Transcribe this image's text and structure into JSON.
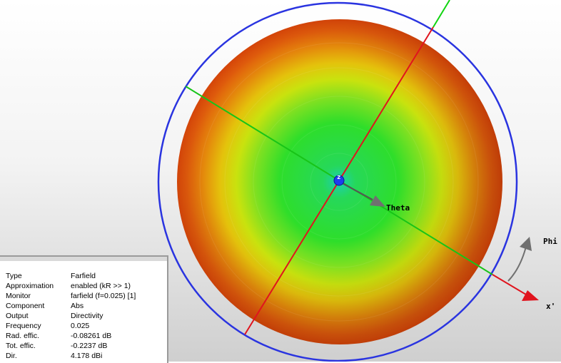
{
  "viewport": {
    "axis_labels": {
      "theta": "Theta",
      "phi": "Phi",
      "x": "x'",
      "z": "z"
    },
    "colors": {
      "boundary_circle": "#2a34e0",
      "axis_red": "#e0141e",
      "axis_green": "#10d410",
      "arrow_gray": "#707070",
      "center_marker": "#1e3cf0"
    }
  },
  "info": {
    "rows": [
      {
        "key": "Type",
        "value": "Farfield"
      },
      {
        "key": "Approximation",
        "value": "enabled (kR >> 1)"
      },
      {
        "key": "Monitor",
        "value": "farfield (f=0.025) [1]"
      },
      {
        "key": "Component",
        "value": "Abs"
      },
      {
        "key": "Output",
        "value": "Directivity"
      },
      {
        "key": "Frequency",
        "value": "0.025"
      },
      {
        "key": "Rad. effic.",
        "value": "-0.08261 dB"
      },
      {
        "key": "Tot. effic.",
        "value": "-0.2237 dB"
      },
      {
        "key": "Dir.",
        "value": "4.178 dBi"
      }
    ]
  }
}
